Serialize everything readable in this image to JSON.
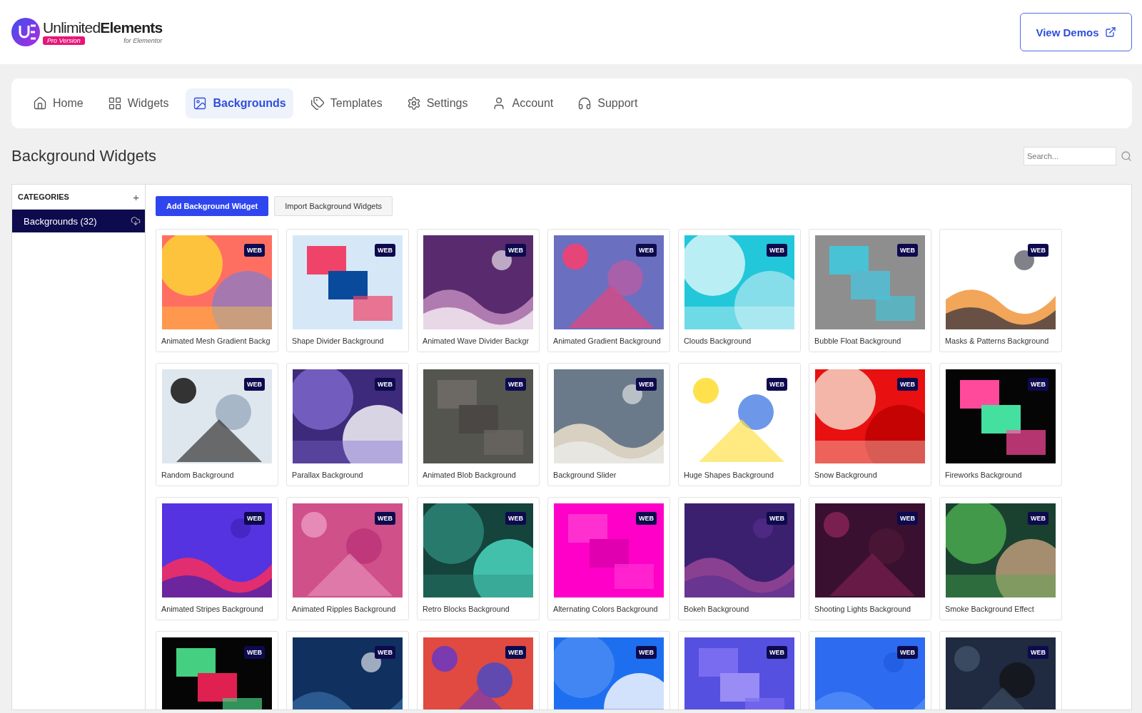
{
  "brand": {
    "name_light": "Unlimited",
    "name_bold": "Elements",
    "edition": "Pro Version",
    "tagline": "for Elementor"
  },
  "header_button": {
    "label": "View Demos"
  },
  "nav": [
    {
      "label": "Home",
      "selected": false
    },
    {
      "label": "Widgets",
      "selected": false
    },
    {
      "label": "Backgrounds",
      "selected": true
    },
    {
      "label": "Templates",
      "selected": false
    },
    {
      "label": "Settings",
      "selected": false
    },
    {
      "label": "Account",
      "selected": false
    },
    {
      "label": "Support",
      "selected": false
    }
  ],
  "page_title": "Background Widgets",
  "search": {
    "placeholder": "Search..."
  },
  "sidebar": {
    "heading": "CATEGORIES",
    "add": "+",
    "items": [
      {
        "label": "Backgrounds (32)",
        "selected": true
      }
    ]
  },
  "actions": [
    {
      "label": "Add Background Widget",
      "kind": "primary"
    },
    {
      "label": "Import Background Widgets",
      "kind": "secondary"
    }
  ],
  "widgets": [
    {
      "title": "Animated Mesh Gradient Backg",
      "badge": "WEB"
    },
    {
      "title": "Shape Divider Background",
      "badge": "WEB"
    },
    {
      "title": "Animated Wave Divider Backgr",
      "badge": "WEB"
    },
    {
      "title": "Animated Gradient Background",
      "badge": "WEB"
    },
    {
      "title": "Clouds Background",
      "badge": "WEB"
    },
    {
      "title": "Bubble Float Background",
      "badge": "WEB"
    },
    {
      "title": "Masks & Patterns Background",
      "badge": "WEB"
    },
    {
      "title": "Random Background",
      "badge": "WEB"
    },
    {
      "title": "Parallax Background",
      "badge": "WEB"
    },
    {
      "title": "Animated Blob Background",
      "badge": "WEB"
    },
    {
      "title": "Background Slider",
      "badge": "WEB"
    },
    {
      "title": "Huge Shapes Background",
      "badge": "WEB"
    },
    {
      "title": "Snow Background",
      "badge": "WEB"
    },
    {
      "title": "Fireworks Background",
      "badge": "WEB"
    },
    {
      "title": "Animated Stripes Background",
      "badge": "WEB"
    },
    {
      "title": "Animated Ripples Background",
      "badge": "WEB"
    },
    {
      "title": "Retro Blocks Background",
      "badge": "WEB"
    },
    {
      "title": "Alternating Colors Background",
      "badge": "WEB"
    },
    {
      "title": "Bokeh Background",
      "badge": "WEB"
    },
    {
      "title": "Shooting Lights Background",
      "badge": "WEB"
    },
    {
      "title": "Smoke Background Effect",
      "badge": "WEB"
    },
    {
      "badge": "WEB"
    },
    {
      "badge": "WEB"
    },
    {
      "badge": "WEB"
    },
    {
      "badge": "WEB"
    },
    {
      "badge": "WEB"
    },
    {
      "badge": "WEB"
    },
    {
      "badge": "WEB"
    }
  ]
}
